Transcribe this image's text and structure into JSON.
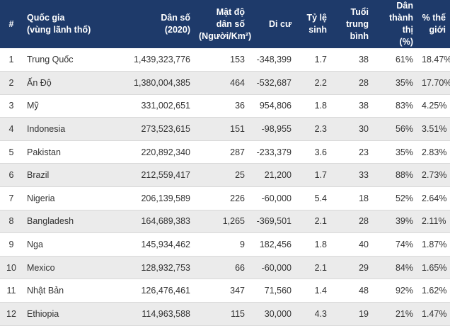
{
  "headers": {
    "rank": "#",
    "country": [
      "Quốc gia",
      "(vùng lãnh thổ)"
    ],
    "population": [
      "Dân số",
      "(2020)"
    ],
    "density": [
      "Mật độ",
      "dân số",
      "(Người/Km²)"
    ],
    "migration": "Di cư",
    "fertility": [
      "Tỷ lệ",
      "sinh"
    ],
    "median_age": [
      "Tuổi",
      "trung",
      "bình"
    ],
    "urban": [
      "Dân",
      "thành thị",
      "(%)"
    ],
    "world_share": [
      "% thế",
      "giới"
    ]
  },
  "rows": [
    {
      "rank": "1",
      "country": "Trung Quốc",
      "population": "1,439,323,776",
      "density": "153",
      "migration": "-348,399",
      "fertility": "1.7",
      "median_age": "38",
      "urban": "61%",
      "world_share": "18.47%"
    },
    {
      "rank": "2",
      "country": "Ấn Độ",
      "population": "1,380,004,385",
      "density": "464",
      "migration": "-532,687",
      "fertility": "2.2",
      "median_age": "28",
      "urban": "35%",
      "world_share": "17.70%"
    },
    {
      "rank": "3",
      "country": "Mỹ",
      "population": "331,002,651",
      "density": "36",
      "migration": "954,806",
      "fertility": "1.8",
      "median_age": "38",
      "urban": "83%",
      "world_share": "4.25%"
    },
    {
      "rank": "4",
      "country": "Indonesia",
      "population": "273,523,615",
      "density": "151",
      "migration": "-98,955",
      "fertility": "2.3",
      "median_age": "30",
      "urban": "56%",
      "world_share": "3.51%"
    },
    {
      "rank": "5",
      "country": "Pakistan",
      "population": "220,892,340",
      "density": "287",
      "migration": "-233,379",
      "fertility": "3.6",
      "median_age": "23",
      "urban": "35%",
      "world_share": "2.83%"
    },
    {
      "rank": "6",
      "country": "Brazil",
      "population": "212,559,417",
      "density": "25",
      "migration": "21,200",
      "fertility": "1.7",
      "median_age": "33",
      "urban": "88%",
      "world_share": "2.73%"
    },
    {
      "rank": "7",
      "country": "Nigeria",
      "population": "206,139,589",
      "density": "226",
      "migration": "-60,000",
      "fertility": "5.4",
      "median_age": "18",
      "urban": "52%",
      "world_share": "2.64%"
    },
    {
      "rank": "8",
      "country": "Bangladesh",
      "population": "164,689,383",
      "density": "1,265",
      "migration": "-369,501",
      "fertility": "2.1",
      "median_age": "28",
      "urban": "39%",
      "world_share": "2.11%"
    },
    {
      "rank": "9",
      "country": "Nga",
      "population": "145,934,462",
      "density": "9",
      "migration": "182,456",
      "fertility": "1.8",
      "median_age": "40",
      "urban": "74%",
      "world_share": "1.87%"
    },
    {
      "rank": "10",
      "country": "Mexico",
      "population": "128,932,753",
      "density": "66",
      "migration": "-60,000",
      "fertility": "2.1",
      "median_age": "29",
      "urban": "84%",
      "world_share": "1.65%"
    },
    {
      "rank": "11",
      "country": "Nhật Bản",
      "population": "126,476,461",
      "density": "347",
      "migration": "71,560",
      "fertility": "1.4",
      "median_age": "48",
      "urban": "92%",
      "world_share": "1.62%"
    },
    {
      "rank": "12",
      "country": "Ethiopia",
      "population": "114,963,588",
      "density": "115",
      "migration": "30,000",
      "fertility": "4.3",
      "median_age": "19",
      "urban": "21%",
      "world_share": "1.47%"
    }
  ]
}
